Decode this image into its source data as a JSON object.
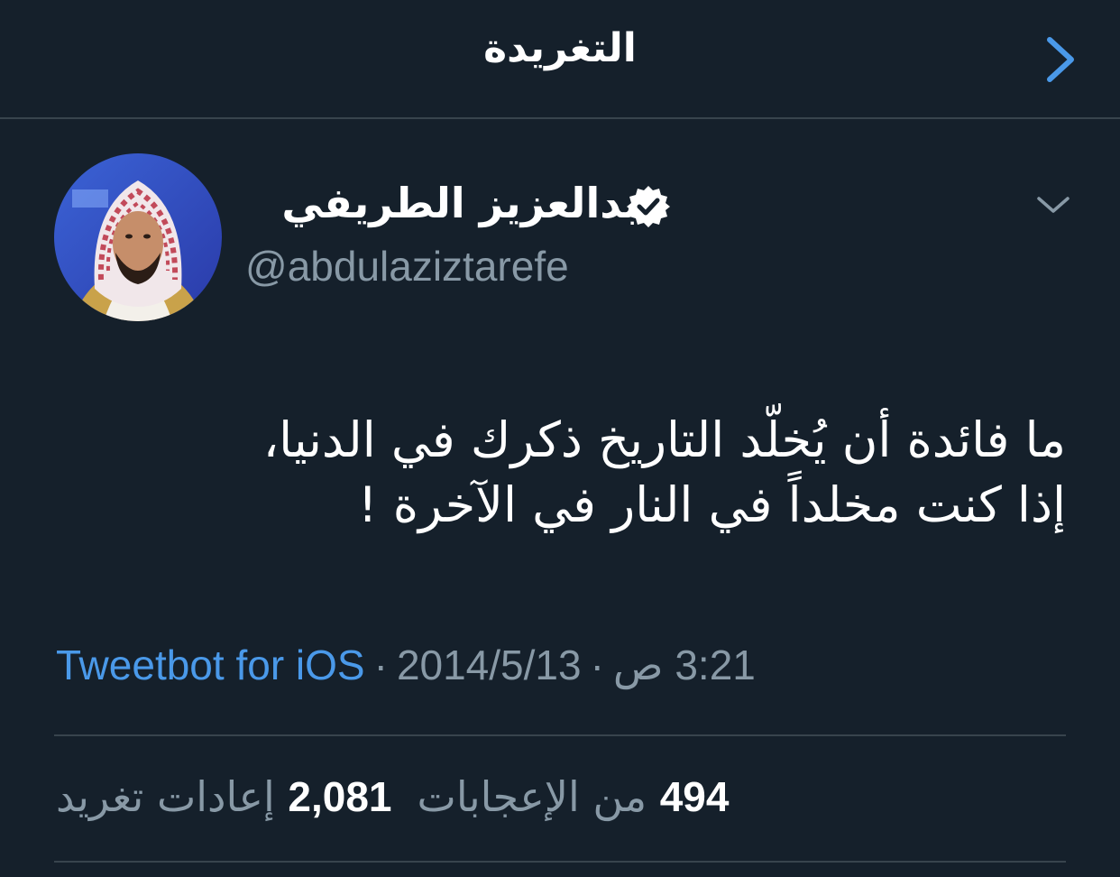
{
  "header": {
    "title": "التغريدة",
    "back_icon": "chevron-right-icon"
  },
  "colors": {
    "background": "#15202b",
    "accent": "#4a99e9",
    "secondary_text": "#8899a6",
    "divider": "#38444d"
  },
  "tweet": {
    "author": {
      "name": "عبدالعزيز الطريفي",
      "handle": "@abdulaziztarefe",
      "verified_icon": "verified-badge-icon"
    },
    "menu_icon": "chevron-down-icon",
    "text_lines": [
      "ما فائدة أن يُخلّد التاريخ ذكرك في الدنيا،",
      "إذا كنت مخلداً في النار في الآخرة !"
    ],
    "time": "3:21 ص",
    "date": "2014/5/13",
    "separator": "·",
    "source": "Tweetbot for iOS",
    "likes": {
      "count": "494",
      "label": "من الإعجابات"
    },
    "retweets": {
      "count": "2,081",
      "label": "إعادات تغريد"
    }
  }
}
